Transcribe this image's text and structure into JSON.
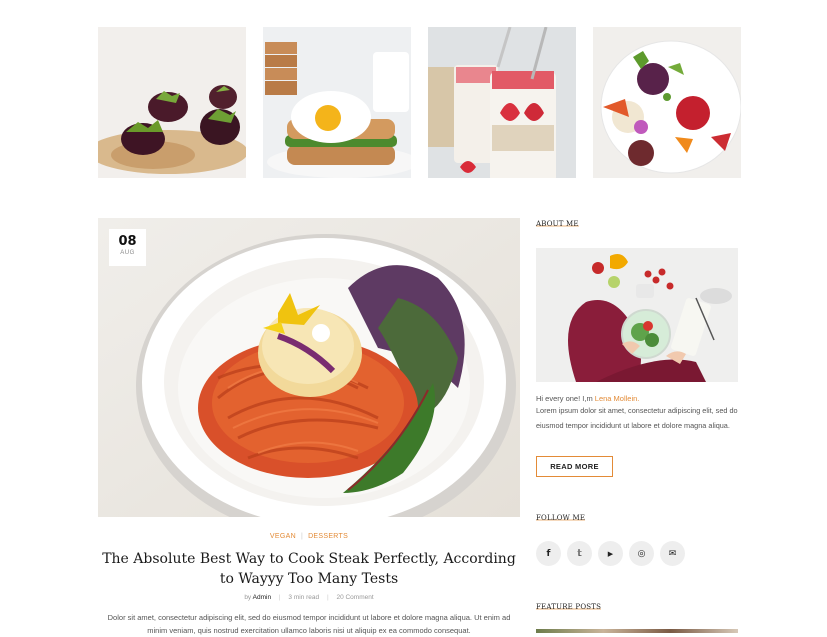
{
  "gallery": {
    "items": [
      {
        "name": "beet-bites"
      },
      {
        "name": "egg-sandwich"
      },
      {
        "name": "strawberry-oats"
      },
      {
        "name": "fruit-salad"
      }
    ]
  },
  "post": {
    "date_day": "08",
    "date_month": "AUG",
    "categories": [
      "VEGAN",
      "DESSERTS"
    ],
    "category_separator": "|",
    "title": "The Absolute Best Way to Cook Steak Perfectly, According to Wayyy Too Many Tests",
    "author_prefix": "by",
    "author": "Admin",
    "read_time": "3 min read",
    "comments": "20 Comment",
    "excerpt": "Dolor sit amet, consectetur adipiscing elit, sed do eiusmod tempor incididunt ut labore et dolore magna aliqua. Ut enim ad minim veniam, quis nostrud exercitation ullamco laboris nisi ut aliquip ex ea commodo consequat."
  },
  "sidebar": {
    "about_heading": "ABOUT ME",
    "greeting": "Hi every one! I,m",
    "author_name": "Lena Mollein.",
    "about_text": "Lorem ipsum dolor sit amet, consectetur adipiscing elit, sed do eiusmod tempor incididunt ut labore et dolore magna aliqua.",
    "read_more": "READ MORE",
    "follow_heading": "FOLLOW ME",
    "social": [
      {
        "icon": "facebook-icon",
        "glyph": "f"
      },
      {
        "icon": "twitter-icon",
        "glyph": "𝕥"
      },
      {
        "icon": "youtube-icon",
        "glyph": "▶"
      },
      {
        "icon": "instagram-icon",
        "glyph": "◎"
      },
      {
        "icon": "email-icon",
        "glyph": "✉"
      }
    ],
    "feature_heading": "FEATURE POSTS"
  },
  "colors": {
    "accent": "#e38b37",
    "heading": "#1a1a1a",
    "body_text": "#555555",
    "social_bg": "#eeeeee"
  }
}
